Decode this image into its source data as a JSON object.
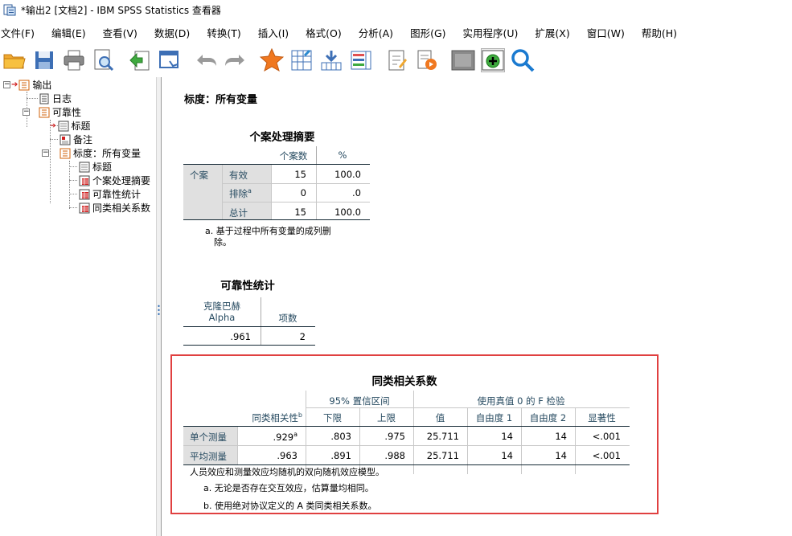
{
  "window": {
    "title": "*输出2 [文档2] - IBM SPSS Statistics 查看器"
  },
  "menu": [
    "文件(F)",
    "编辑(E)",
    "查看(V)",
    "数据(D)",
    "转换(T)",
    "插入(I)",
    "格式(O)",
    "分析(A)",
    "图形(G)",
    "实用程序(U)",
    "扩展(X)",
    "窗口(W)",
    "帮助(H)"
  ],
  "toolbar_icons": [
    "open-icon",
    "save-icon",
    "print-icon",
    "print-preview-icon",
    "export-icon",
    "go-to-data-icon",
    "undo-icon",
    "redo-icon",
    "star-icon",
    "goto-case-icon",
    "variables-icon",
    "data-table-icon",
    "script-icon",
    "syntax-icon",
    "window-icon",
    "designate-window-icon",
    "search-icon"
  ],
  "tree": {
    "root": "输出",
    "log": "日志",
    "reliability": "可靠性",
    "title1": "标题",
    "notes": "备注",
    "scale": "标度：所有变量",
    "title2": "标题",
    "case_summary": "个案处理摘要",
    "rel_stats": "可靠性统计",
    "icc": "同类相关系数"
  },
  "content": {
    "scale_heading": "标度：所有变量",
    "case_table": {
      "title": "个案处理摘要",
      "col_n": "个案数",
      "col_pct": "%",
      "row_group": "个案",
      "rows": [
        {
          "label": "有效",
          "sup": "",
          "n": "15",
          "pct": "100.0"
        },
        {
          "label": "排除",
          "sup": "a",
          "n": "0",
          "pct": ".0"
        },
        {
          "label": "总计",
          "sup": "",
          "n": "15",
          "pct": "100.0"
        }
      ],
      "footnote_line1": "a. 基于过程中所有变量的成列删",
      "footnote_line2": "除。"
    },
    "rel_table": {
      "title": "可靠性统计",
      "col_alpha_1": "克隆巴赫",
      "col_alpha_2": "Alpha",
      "col_items": "项数",
      "alpha": ".961",
      "items": "2"
    },
    "icc_table": {
      "title": "同类相关系数",
      "col_icc": "同类相关性",
      "col_icc_sup": "b",
      "ci_group": "95% 置信区间",
      "ci_lower": "下限",
      "ci_upper": "上限",
      "f_group": "使用真值 0 的 F 检验",
      "f_value": "值",
      "df1": "自由度 1",
      "df2": "自由度 2",
      "sig": "显著性",
      "rows": [
        {
          "label": "单个测量",
          "icc": ".929",
          "sup": "a",
          "lower": ".803",
          "upper": ".975",
          "f": "25.711",
          "df1": "14",
          "df2": "14",
          "sig": "<.001"
        },
        {
          "label": "平均测量",
          "icc": ".963",
          "sup": "",
          "lower": ".891",
          "upper": ".988",
          "f": "25.711",
          "df1": "14",
          "df2": "14",
          "sig": "<.001"
        }
      ],
      "note_model": "人员效应和测量效应均随机的双向随机效应模型。",
      "note_a": "a. 无论是否存在交互效应，估算量均相同。",
      "note_b": "b. 使用绝对协议定义的 A 类同类相关系数。"
    }
  }
}
